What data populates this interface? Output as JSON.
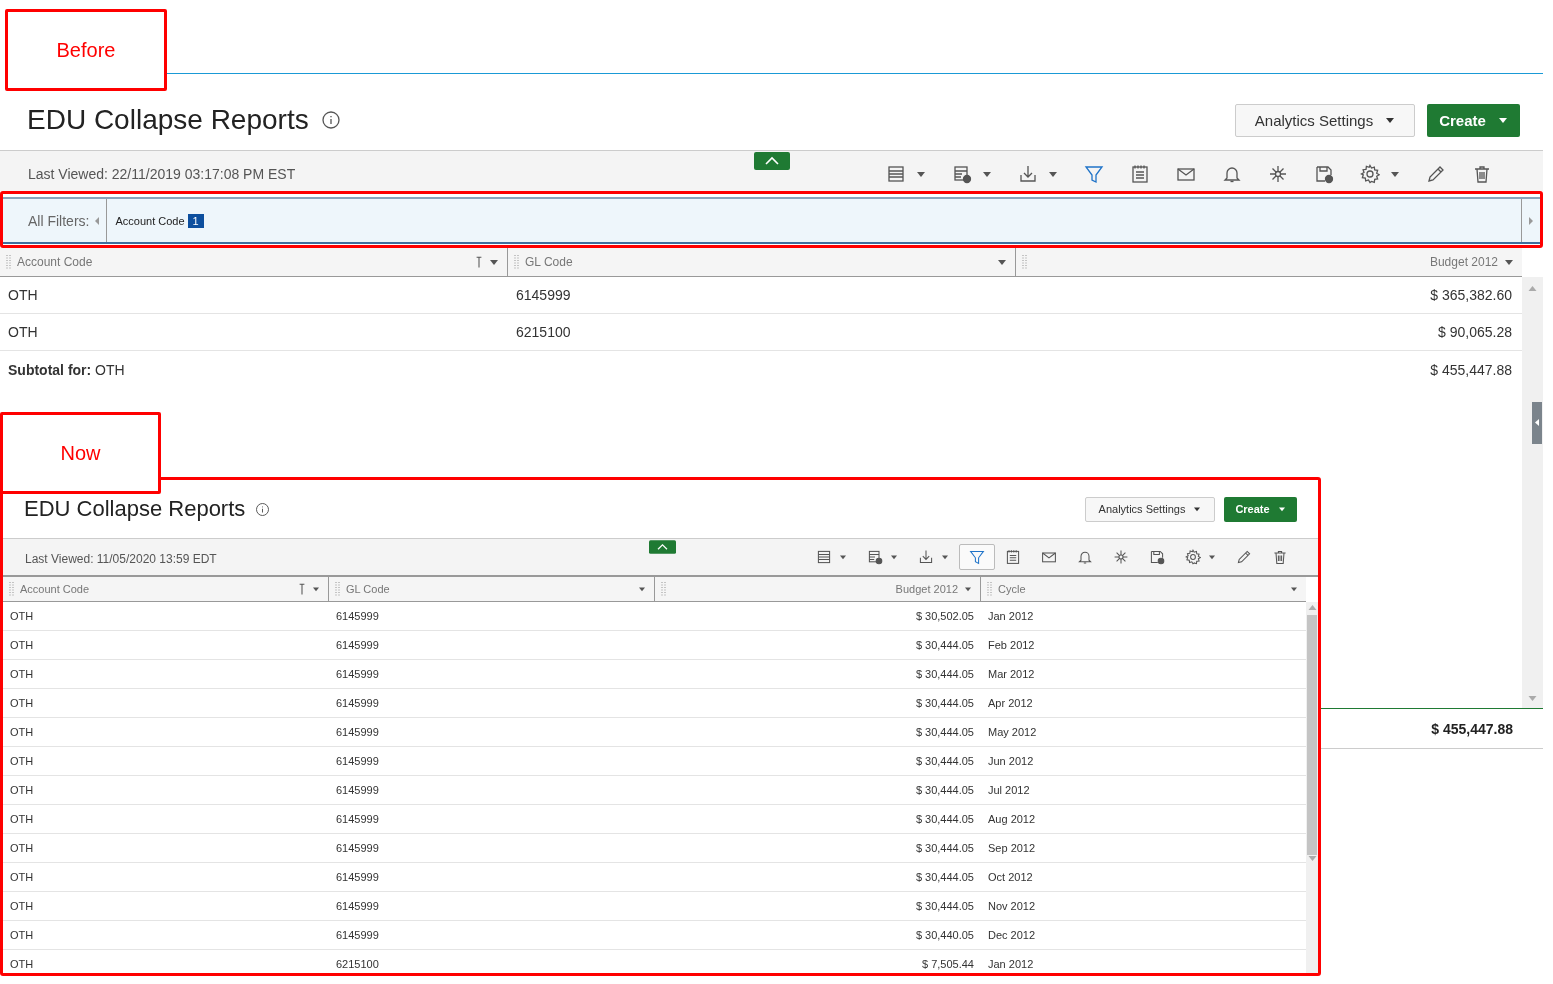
{
  "before": {
    "label": "Before",
    "title": "EDU Collapse Reports",
    "buttons": [
      {
        "label": "Analytics Settings",
        "kind": "secondary"
      },
      {
        "label": "Create",
        "kind": "primary"
      }
    ],
    "last_viewed": "Last Viewed: 22/11/2019 03:17:08 PM EST",
    "tools": [
      {
        "kind": "columns",
        "dropdown": true,
        "selected": false
      },
      {
        "kind": "table",
        "dropdown": true,
        "selected": false
      },
      {
        "kind": "download",
        "dropdown": true,
        "selected": false
      },
      {
        "kind": "filter",
        "dropdown": false,
        "selected": true
      },
      {
        "kind": "notes",
        "dropdown": false,
        "selected": false
      },
      {
        "kind": "mail",
        "dropdown": false,
        "selected": false
      },
      {
        "kind": "bell",
        "dropdown": false,
        "selected": false
      },
      {
        "kind": "network",
        "dropdown": false,
        "selected": false
      },
      {
        "kind": "save",
        "dropdown": false,
        "selected": false
      },
      {
        "kind": "settings",
        "dropdown": true,
        "selected": false
      },
      {
        "kind": "edit",
        "dropdown": false,
        "selected": false
      },
      {
        "kind": "delete",
        "dropdown": false,
        "selected": false
      }
    ],
    "filters": {
      "label": "All Filters:",
      "chips": [
        {
          "label": "Account Code",
          "count": "1"
        }
      ]
    },
    "columns": [
      {
        "label": "Account Code",
        "sorted": true,
        "kind": "text"
      },
      {
        "label": "GL Code",
        "sorted": false,
        "kind": "text"
      },
      {
        "label": "Budget 2012",
        "sorted": false,
        "kind": "amount"
      }
    ],
    "rows": [
      [
        "OTH",
        "6145999",
        "$ 365,382.60"
      ],
      [
        "OTH",
        "6215100",
        "$ 90,065.28"
      ]
    ],
    "subtotal": {
      "label": "**Subtotal for:** OTH",
      "amount": "$ 455,447.88"
    },
    "grand_total": "$ 455,447.88"
  },
  "now": {
    "label": "Now",
    "title": "EDU Collapse Reports",
    "buttons": [
      {
        "label": "Analytics Settings",
        "kind": "secondary"
      },
      {
        "label": "Create",
        "kind": "primary"
      }
    ],
    "last_viewed": "Last Viewed: 11/05/2020 13:59 EDT",
    "tools": [
      {
        "kind": "columns",
        "dropdown": true,
        "selected": false
      },
      {
        "kind": "table",
        "dropdown": true,
        "selected": false
      },
      {
        "kind": "download",
        "dropdown": true,
        "selected": false
      },
      {
        "kind": "filter",
        "dropdown": false,
        "selected": true
      },
      {
        "kind": "notes",
        "dropdown": false,
        "selected": false
      },
      {
        "kind": "mail",
        "dropdown": false,
        "selected": false
      },
      {
        "kind": "bell",
        "dropdown": false,
        "selected": false
      },
      {
        "kind": "network",
        "dropdown": false,
        "selected": false
      },
      {
        "kind": "save",
        "dropdown": false,
        "selected": false
      },
      {
        "kind": "settings",
        "dropdown": true,
        "selected": false
      },
      {
        "kind": "edit",
        "dropdown": false,
        "selected": false
      },
      {
        "kind": "delete",
        "dropdown": false,
        "selected": false
      }
    ],
    "columns": [
      {
        "label": "Account Code",
        "sorted": true,
        "kind": "text"
      },
      {
        "label": "GL Code",
        "sorted": false,
        "kind": "text"
      },
      {
        "label": "Budget 2012",
        "sorted": false,
        "kind": "amount"
      },
      {
        "label": "Cycle",
        "sorted": false,
        "kind": "text"
      }
    ],
    "rows": [
      [
        "OTH",
        "6145999",
        "$ 30,502.05",
        "Jan 2012"
      ],
      [
        "OTH",
        "6145999",
        "$ 30,444.05",
        "Feb 2012"
      ],
      [
        "OTH",
        "6145999",
        "$ 30,444.05",
        "Mar 2012"
      ],
      [
        "OTH",
        "6145999",
        "$ 30,444.05",
        "Apr 2012"
      ],
      [
        "OTH",
        "6145999",
        "$ 30,444.05",
        "May 2012"
      ],
      [
        "OTH",
        "6145999",
        "$ 30,444.05",
        "Jun 2012"
      ],
      [
        "OTH",
        "6145999",
        "$ 30,444.05",
        "Jul 2012"
      ],
      [
        "OTH",
        "6145999",
        "$ 30,444.05",
        "Aug 2012"
      ],
      [
        "OTH",
        "6145999",
        "$ 30,444.05",
        "Sep 2012"
      ],
      [
        "OTH",
        "6145999",
        "$ 30,444.05",
        "Oct 2012"
      ],
      [
        "OTH",
        "6145999",
        "$ 30,444.05",
        "Nov 2012"
      ],
      [
        "OTH",
        "6145999",
        "$ 30,440.05",
        "Dec 2012"
      ],
      [
        "OTH",
        "6215100",
        "$ 7,505.44",
        "Jan 2012"
      ]
    ]
  }
}
